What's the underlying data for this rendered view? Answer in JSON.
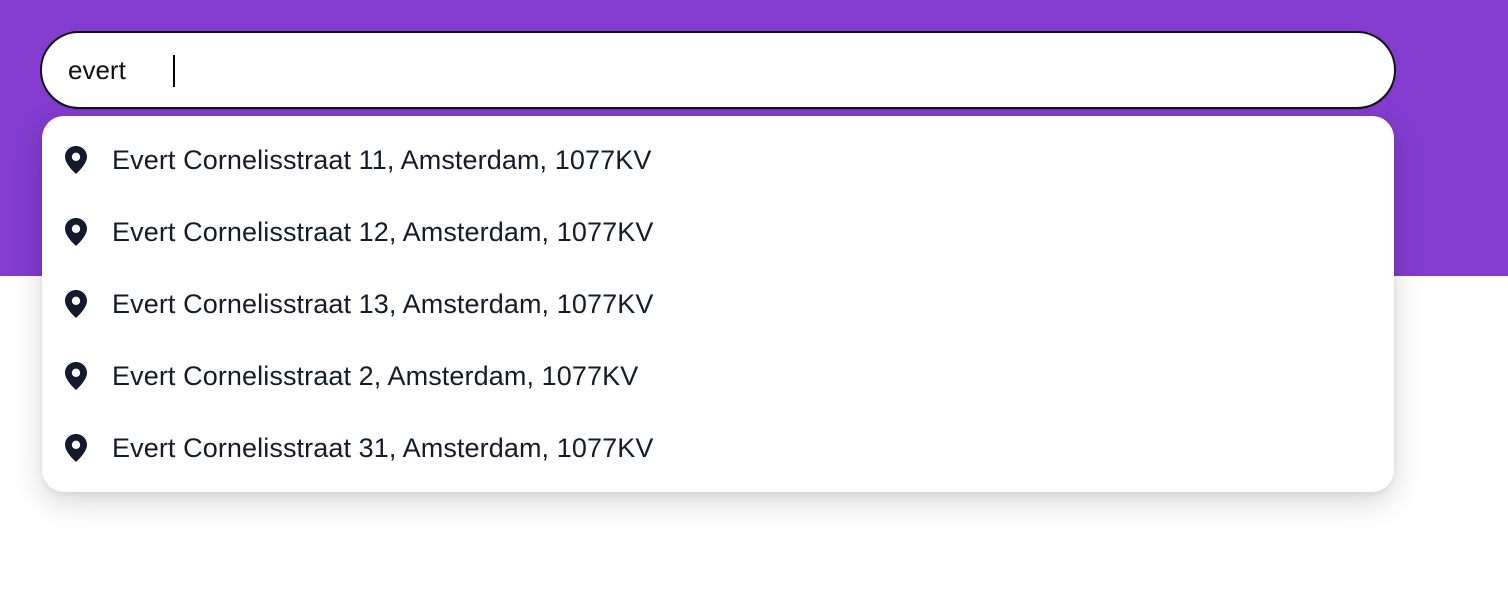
{
  "colors": {
    "brand_purple": "#833CCF",
    "text_dark": "#161B2A",
    "pin_icon": "#131A2B"
  },
  "search": {
    "value": "evert"
  },
  "suggestions": [
    {
      "icon": "map-pin-icon",
      "label": "Evert Cornelisstraat 11, Amsterdam, 1077KV"
    },
    {
      "icon": "map-pin-icon",
      "label": "Evert Cornelisstraat 12, Amsterdam, 1077KV"
    },
    {
      "icon": "map-pin-icon",
      "label": "Evert Cornelisstraat 13, Amsterdam, 1077KV"
    },
    {
      "icon": "map-pin-icon",
      "label": "Evert Cornelisstraat 2, Amsterdam, 1077KV"
    },
    {
      "icon": "map-pin-icon",
      "label": "Evert Cornelisstraat 31, Amsterdam, 1077KV"
    }
  ]
}
